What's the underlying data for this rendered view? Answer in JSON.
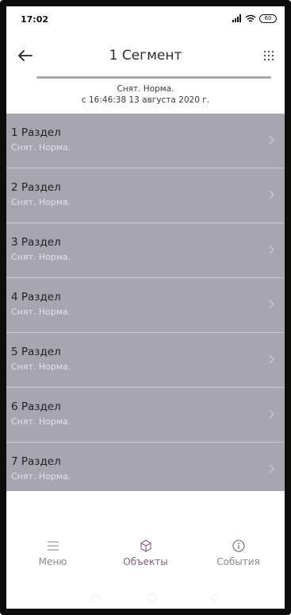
{
  "status_bar": {
    "time": "17:02",
    "battery": "60"
  },
  "header": {
    "title": "1 Сегмент"
  },
  "segment_status": {
    "line1": "Снят. Норма.",
    "line2": "с 16:46:38 13 августа 2020 г."
  },
  "sections": [
    {
      "label": "1 Раздел",
      "status": "Снят. Норма."
    },
    {
      "label": "2 Раздел",
      "status": "Снят. Норма."
    },
    {
      "label": "3 Раздел",
      "status": "Снят. Норма."
    },
    {
      "label": "4 Раздел",
      "status": "Снят. Норма."
    },
    {
      "label": "5 Раздел",
      "status": "Снят. Норма."
    },
    {
      "label": "6 Раздел",
      "status": "Снят. Норма."
    },
    {
      "label": "7 Раздел",
      "status": "Снят. Норма."
    }
  ],
  "tabs": [
    {
      "label": "Меню",
      "icon": "menu-icon"
    },
    {
      "label": "Объекты",
      "icon": "cube-icon"
    },
    {
      "label": "События",
      "icon": "info-icon"
    }
  ],
  "active_tab": "Объекты",
  "colors": {
    "list_bg": "#a7a6b0",
    "accent": "#8a5a8e"
  }
}
